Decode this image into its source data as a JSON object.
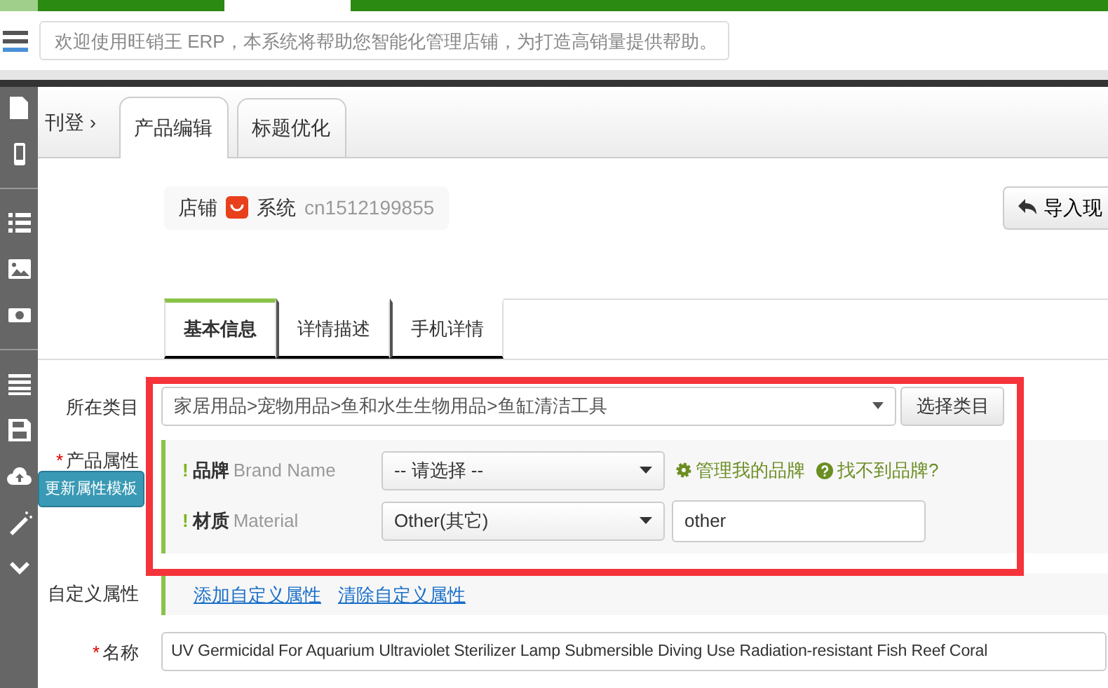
{
  "notice": {
    "text": "欢迎使用旺销王 ERP，本系统将帮助您智能化管理店铺，为打造高销量提供帮助。"
  },
  "breadcrumb": {
    "text": "刊登",
    "separator": "›"
  },
  "page_tabs": [
    {
      "label": "产品编辑",
      "selected": true
    },
    {
      "label": "标题优化",
      "selected": false
    }
  ],
  "shop": {
    "label": "店铺",
    "platform": "系统",
    "account": "cn1512199855"
  },
  "import_button": {
    "label": "导入现"
  },
  "form_tabs": [
    {
      "label": "基本信息",
      "selected": true
    },
    {
      "label": "详情描述",
      "selected": false
    },
    {
      "label": "手机详情",
      "selected": false
    }
  ],
  "category": {
    "label": "所在类目",
    "value": "家居用品>宠物用品>鱼和水生生物用品>鱼缸清洁工具",
    "button": "选择类目"
  },
  "attributes": {
    "label": "产品属性",
    "required_mark": "*",
    "template_button": "更新属性模板",
    "items": [
      {
        "kind": "select",
        "mark": "!",
        "name": "品牌",
        "hint": "Brand Name",
        "value": "-- 请选择 --",
        "links": [
          {
            "kind": "manage",
            "label": "管理我的品牌"
          },
          {
            "kind": "help",
            "label": "找不到品牌?"
          }
        ]
      },
      {
        "kind": "select_input",
        "mark": "!",
        "name": "材质",
        "hint": "Material",
        "value": "Other(其它)",
        "input": "other"
      }
    ]
  },
  "custom_attributes": {
    "label": "自定义属性",
    "links": [
      "添加自定义属性",
      "清除自定义属性"
    ]
  },
  "title_field": {
    "label": "名称",
    "required_mark": "*",
    "value": "UV Germicidal For Aquarium Ultraviolet Sterilizer Lamp Submersible Diving Use Radiation-resistant Fish Reef Coral"
  }
}
